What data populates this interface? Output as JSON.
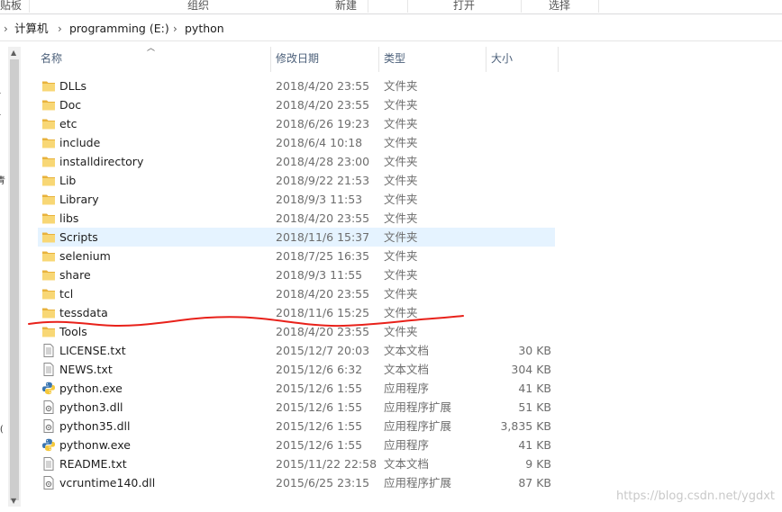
{
  "ribbon": {
    "groups": [
      {
        "label": "贴板"
      },
      {
        "label": "组织"
      },
      {
        "label": "新建"
      },
      {
        "label": "打开"
      },
      {
        "label": "选择"
      }
    ]
  },
  "address": {
    "crumbs": [
      "计算机",
      "programming (E:)",
      "python"
    ]
  },
  "columns": {
    "name": "名称",
    "date": "修改日期",
    "type": "类型",
    "size": "大小"
  },
  "nav_fragments": [
    "青",
    "(("
  ],
  "files": [
    {
      "name": "DLLs",
      "date": "2018/4/20 23:55",
      "type": "文件夹",
      "size": "",
      "icon": "folder-icon"
    },
    {
      "name": "Doc",
      "date": "2018/4/20 23:55",
      "type": "文件夹",
      "size": "",
      "icon": "folder-icon"
    },
    {
      "name": "etc",
      "date": "2018/6/26 19:23",
      "type": "文件夹",
      "size": "",
      "icon": "folder-icon"
    },
    {
      "name": "include",
      "date": "2018/6/4 10:18",
      "type": "文件夹",
      "size": "",
      "icon": "folder-icon"
    },
    {
      "name": "installdirectory",
      "date": "2018/4/28 23:00",
      "type": "文件夹",
      "size": "",
      "icon": "folder-icon"
    },
    {
      "name": "Lib",
      "date": "2018/9/22 21:53",
      "type": "文件夹",
      "size": "",
      "icon": "folder-icon"
    },
    {
      "name": "Library",
      "date": "2018/9/3 11:53",
      "type": "文件夹",
      "size": "",
      "icon": "folder-icon"
    },
    {
      "name": "libs",
      "date": "2018/4/20 23:55",
      "type": "文件夹",
      "size": "",
      "icon": "folder-icon"
    },
    {
      "name": "Scripts",
      "date": "2018/11/6 15:37",
      "type": "文件夹",
      "size": "",
      "icon": "folder-icon",
      "hover": true
    },
    {
      "name": "selenium",
      "date": "2018/7/25 16:35",
      "type": "文件夹",
      "size": "",
      "icon": "folder-icon"
    },
    {
      "name": "share",
      "date": "2018/9/3 11:55",
      "type": "文件夹",
      "size": "",
      "icon": "folder-icon"
    },
    {
      "name": "tcl",
      "date": "2018/4/20 23:55",
      "type": "文件夹",
      "size": "",
      "icon": "folder-icon"
    },
    {
      "name": "tessdata",
      "date": "2018/11/6 15:25",
      "type": "文件夹",
      "size": "",
      "icon": "folder-icon"
    },
    {
      "name": "Tools",
      "date": "2018/4/20 23:55",
      "type": "文件夹",
      "size": "",
      "icon": "folder-icon"
    },
    {
      "name": "LICENSE.txt",
      "date": "2015/12/7 20:03",
      "type": "文本文档",
      "size": "30 KB",
      "icon": "text-file-icon"
    },
    {
      "name": "NEWS.txt",
      "date": "2015/12/6 6:32",
      "type": "文本文档",
      "size": "304 KB",
      "icon": "text-file-icon"
    },
    {
      "name": "python.exe",
      "date": "2015/12/6 1:55",
      "type": "应用程序",
      "size": "41 KB",
      "icon": "python-icon"
    },
    {
      "name": "python3.dll",
      "date": "2015/12/6 1:55",
      "type": "应用程序扩展",
      "size": "51 KB",
      "icon": "dll-file-icon"
    },
    {
      "name": "python35.dll",
      "date": "2015/12/6 1:55",
      "type": "应用程序扩展",
      "size": "3,835 KB",
      "icon": "dll-file-icon"
    },
    {
      "name": "pythonw.exe",
      "date": "2015/12/6 1:55",
      "type": "应用程序",
      "size": "41 KB",
      "icon": "python-icon"
    },
    {
      "name": "README.txt",
      "date": "2015/11/22 22:58",
      "type": "文本文档",
      "size": "9 KB",
      "icon": "text-file-icon"
    },
    {
      "name": "vcruntime140.dll",
      "date": "2015/6/25 23:15",
      "type": "应用程序扩展",
      "size": "87 KB",
      "icon": "dll-file-icon"
    }
  ],
  "watermark": "https://blog.csdn.net/ygdxt",
  "colors": {
    "folder": "#f8d775",
    "hover_row": "#e5f3ff",
    "header_text": "#4c607a",
    "annotation": "#e8211a"
  }
}
